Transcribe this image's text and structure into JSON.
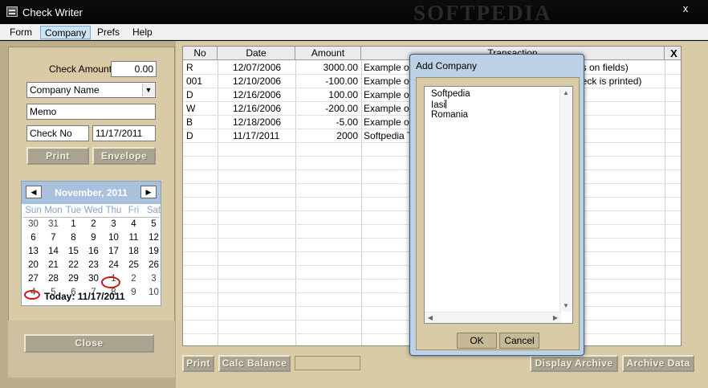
{
  "window": {
    "title": "Check Writer",
    "watermark": "SOFTPEDIA",
    "close_glyph": "x"
  },
  "menu": {
    "items": [
      "Form",
      "Company",
      "Prefs",
      "Help"
    ],
    "active": "Company"
  },
  "form": {
    "check_amount_label": "Check Amount:",
    "check_amount_value": "0.00",
    "company_name_value": "Company Name",
    "memo_value": "Memo",
    "check_no_value": "Check No",
    "date_value": "11/17/2011",
    "print_label": "Print",
    "envelope_label": "Envelope",
    "close_label": "Close"
  },
  "calendar": {
    "month_label": "November, 2011",
    "prev_glyph": "◀",
    "next_glyph": "▶",
    "weekdays": [
      "Sun",
      "Mon",
      "Tue",
      "Wed",
      "Thu",
      "Fri",
      "Sat"
    ],
    "weeks": [
      [
        "30",
        "31",
        "1",
        "2",
        "3",
        "4",
        "5"
      ],
      [
        "6",
        "7",
        "8",
        "9",
        "10",
        "11",
        "12"
      ],
      [
        "13",
        "14",
        "15",
        "16",
        "17",
        "18",
        "19"
      ],
      [
        "20",
        "21",
        "22",
        "23",
        "24",
        "25",
        "26"
      ],
      [
        "27",
        "28",
        "29",
        "30",
        "1",
        "2",
        "3"
      ],
      [
        "4",
        "5",
        "6",
        "7",
        "8",
        "9",
        "10"
      ]
    ],
    "today_label": "Today: 11/17/2011"
  },
  "grid": {
    "columns": [
      "No",
      "Date",
      "Amount",
      "Transaction"
    ],
    "close_glyph": "X",
    "rows": [
      {
        "no": "R",
        "date": "12/07/2006",
        "amount": "3000.00",
        "transaction": "Example of",
        "tail": "es on fields)"
      },
      {
        "no": "001",
        "date": "12/10/2006",
        "amount": "-100.00",
        "transaction": "Example of",
        "tail": "heck is printed)"
      },
      {
        "no": "D",
        "date": "12/16/2006",
        "amount": "100.00",
        "transaction": "Example of",
        "tail": ""
      },
      {
        "no": "W",
        "date": "12/16/2006",
        "amount": "-200.00",
        "transaction": "Example of",
        "tail": ""
      },
      {
        "no": "B",
        "date": "12/18/2006",
        "amount": "-5.00",
        "transaction": "Example of",
        "tail": ""
      },
      {
        "no": "D",
        "date": "11/17/2011",
        "amount": "2000",
        "transaction": "Softpedia Te",
        "tail": ""
      }
    ]
  },
  "bottom_buttons": {
    "print": "Print",
    "calc_balance": "Calc Balance",
    "display_archive": "Display Archive",
    "archive_data": "Archive Data"
  },
  "dialog": {
    "title": "Add Company",
    "lines": [
      "Softpedia",
      "Iasi",
      "Romania"
    ],
    "ok_label": "OK",
    "cancel_label": "Cancel"
  }
}
